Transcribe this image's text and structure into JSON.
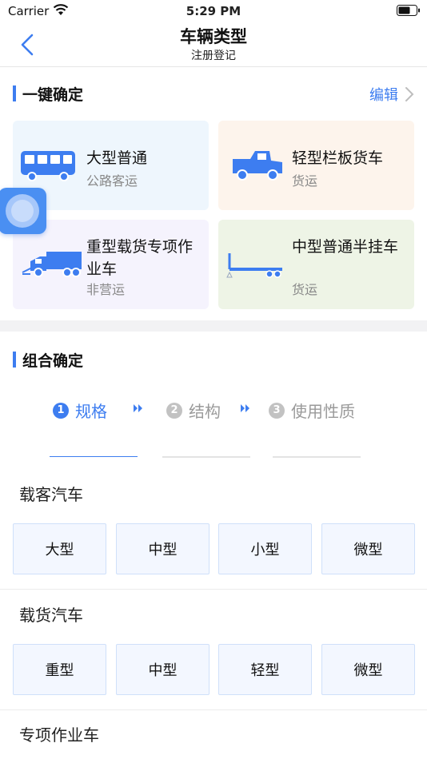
{
  "status_bar": {
    "carrier": "Carrier",
    "time": "5:29 PM"
  },
  "nav": {
    "title": "车辆类型",
    "subtitle": "注册登记"
  },
  "quick_section": {
    "title": "一键确定",
    "edit_label": "编辑",
    "cards": [
      {
        "title": "大型普通",
        "subtitle": "公路客运",
        "icon": "bus-icon",
        "bg": "#eef6fd"
      },
      {
        "title": "轻型栏板货车",
        "subtitle": "货运",
        "icon": "pickup-truck-icon",
        "bg": "#fdf4ec"
      },
      {
        "title": "重型载货专项作业车",
        "subtitle": "非营运",
        "icon": "special-truck-icon",
        "bg": "#f5f3fd"
      },
      {
        "title": "中型普通半挂车",
        "subtitle": "货运",
        "icon": "semi-trailer-icon",
        "bg": "#eef4e6"
      }
    ]
  },
  "combo_section": {
    "title": "组合确定",
    "steps": [
      {
        "num": "1",
        "label": "规格",
        "state": "active"
      },
      {
        "num": "2",
        "label": "结构",
        "state": "inactive"
      },
      {
        "num": "3",
        "label": "使用性质",
        "state": "inactive"
      }
    ],
    "categories": [
      {
        "title": "载客汽车",
        "options": [
          "大型",
          "中型",
          "小型",
          "微型"
        ]
      },
      {
        "title": "载货汽车",
        "options": [
          "重型",
          "中型",
          "轻型",
          "微型"
        ]
      },
      {
        "title": "专项作业车",
        "options": []
      }
    ]
  },
  "colors": {
    "accent": "#3d7df0",
    "step_inactive": "#9a9a9a"
  }
}
